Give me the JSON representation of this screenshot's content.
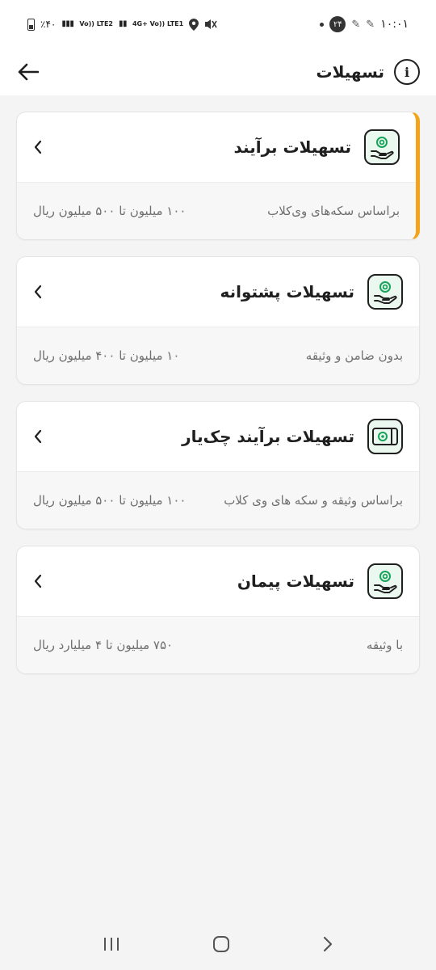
{
  "status_bar": {
    "time": "۱۰:۰۱",
    "notification_count": "۲۴",
    "battery": "٪۴۰",
    "net1": "Vo)) LTE2",
    "net2": "4G+ Vo)) LTE1"
  },
  "header": {
    "title": "تسهیلات"
  },
  "cards": [
    {
      "title": "تسهیلات برآیند",
      "description": "براساس سکه‌های وی‌کلاب",
      "range": "۱۰۰ میلیون تا ۵۰۰ میلیون ریال",
      "accent": "#f2a51a"
    },
    {
      "title": "تسهیلات پشتوانه",
      "description": "بدون ضامن و وثیقه",
      "range": "۱۰ میلیون تا ۴۰۰ میلیون ریال"
    },
    {
      "title": "تسهیلات برآیند چک‌یار",
      "description": "براساس وثیقه و سکه های وی کلاب",
      "range": "۱۰۰ میلیون تا ۵۰۰ میلیون ریال"
    },
    {
      "title": "تسهیلات پیمان",
      "description": "با وثیقه",
      "range": "۷۵۰ میلیون تا ۴ میلیارد ریال"
    }
  ],
  "colors": {
    "icon_bg": "#eaf8ef",
    "icon_stroke": "#17a35a",
    "accent": "#f2a51a"
  }
}
